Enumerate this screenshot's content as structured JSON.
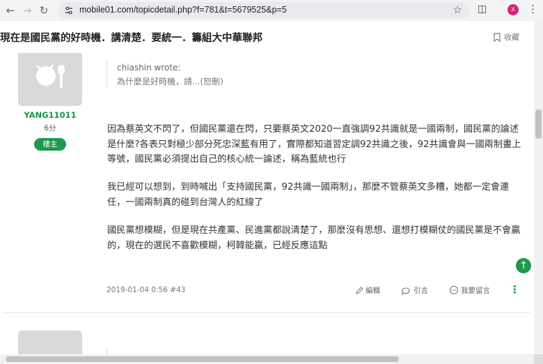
{
  "browser": {
    "url": "mobile01.com/topicdetail.php?f=781&t=5679525&p=5",
    "profile_initial": "x"
  },
  "topic": {
    "title": "現在是國民黨的好時機．講清楚．要統一．籌組大中華聯邦",
    "favorite_label": "收藏"
  },
  "post": {
    "author": {
      "username": "YANG11011",
      "score": "6分",
      "badge": "樓主"
    },
    "quote": {
      "author": "chiashin wrote:",
      "text": "為什麼是好時機，請...(恕刪)"
    },
    "paragraphs": [
      "因為蔡英文不閃了，但國民黨還在閃，只要蔡英文2020一直強調92共識就是一國兩制，國民黨的論述是什麼?各表只對極少部分死忠深藍有用了，實際都知道習定調92共識之後，92共識會與一國兩制畫上等號，國民黨必須提出自己的核心統一論述，稱為藍統也行",
      "我已經可以想到，到時喊出「支持國民黨，92共識一國兩制」，那麼不管蔡英文多糟，她都一定會連任，一國兩制真的碰到台灣人的紅線了",
      "國民黨想模糊，但是現在共產黨、民進黨都說清楚了，那麼沒有思想、還想打模糊仗的國民黨是不會贏的，現在的選民不喜歡模糊，柯韓能贏，已經反應這點"
    ],
    "meta": "2019-01-04 0:56 #43",
    "actions": {
      "edit": "編輯",
      "quote": "引言",
      "reply": "我要留言"
    }
  },
  "colors": {
    "accent_green": "#1d9a4f",
    "username_green": "#0f9a4a"
  },
  "icons": [
    "back-icon",
    "forward-icon",
    "reload-icon",
    "site-info-icon",
    "star-icon",
    "extensions-icon",
    "kebab-menu-icon",
    "bookmark-icon",
    "pencil-icon",
    "quote-icon",
    "comment-icon",
    "scroll-top-icon"
  ]
}
